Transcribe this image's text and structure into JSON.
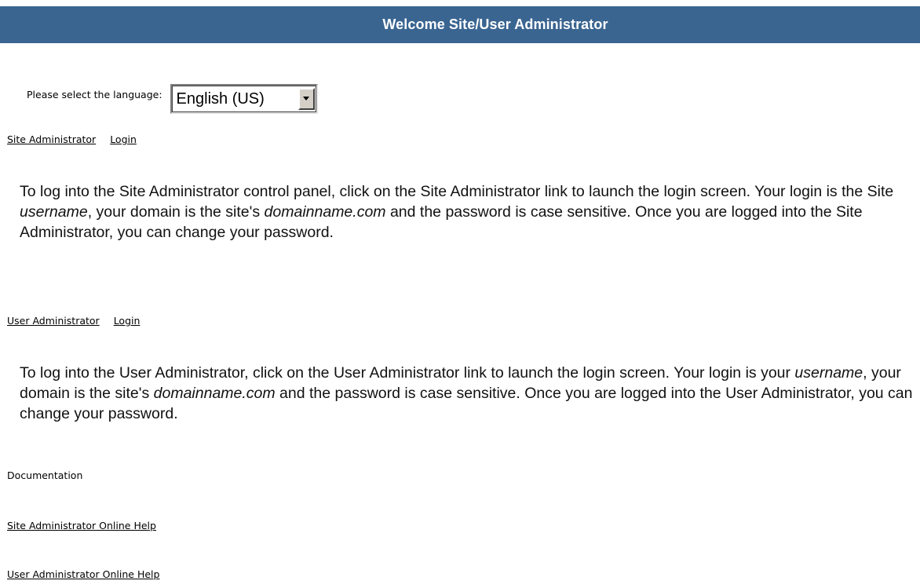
{
  "header": {
    "title": "Welcome Site/User Administrator"
  },
  "language": {
    "label": "Please select the language:",
    "selected": "English (US)"
  },
  "site_admin": {
    "link_label": "Site Administrator",
    "login_label": "Login",
    "desc_1": "To log into the Site Administrator control panel, click on the Site Administrator link to launch the login screen. Your login is the Site ",
    "desc_em_1": "username",
    "desc_2": ", your domain is the site's ",
    "desc_em_2": "domainname.com",
    "desc_3": " and the password is case sensitive. Once you are logged into the Site Administrator, you can change your password."
  },
  "user_admin": {
    "link_label": "User Administrator",
    "login_label": "Login",
    "desc_1": "To log into the User Administrator, click on the User Administrator link to launch the login screen. Your login is your ",
    "desc_em_1": "username",
    "desc_2": ", your domain is the site's ",
    "desc_em_2": "domainname.com",
    "desc_3": " and the password is case sensitive. Once you are logged into the User Administrator, you can change your password."
  },
  "documentation": {
    "heading": "Documentation",
    "site_help": "Site Administrator Online Help",
    "user_help": "User Administrator Online Help"
  },
  "colors": {
    "header_bg": "#3a6591",
    "header_text": "#ffffff"
  },
  "icons": {
    "dropdown": "triangle-down-icon"
  }
}
